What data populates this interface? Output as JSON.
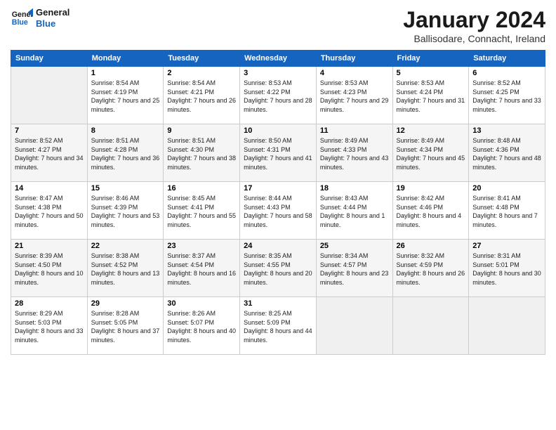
{
  "header": {
    "logo_line1": "General",
    "logo_line2": "Blue",
    "month": "January 2024",
    "location": "Ballisodare, Connacht, Ireland"
  },
  "weekdays": [
    "Sunday",
    "Monday",
    "Tuesday",
    "Wednesday",
    "Thursday",
    "Friday",
    "Saturday"
  ],
  "weeks": [
    [
      {
        "day": "",
        "empty": true
      },
      {
        "day": "1",
        "sunrise": "8:54 AM",
        "sunset": "4:19 PM",
        "daylight": "7 hours and 25 minutes."
      },
      {
        "day": "2",
        "sunrise": "8:54 AM",
        "sunset": "4:21 PM",
        "daylight": "7 hours and 26 minutes."
      },
      {
        "day": "3",
        "sunrise": "8:53 AM",
        "sunset": "4:22 PM",
        "daylight": "7 hours and 28 minutes."
      },
      {
        "day": "4",
        "sunrise": "8:53 AM",
        "sunset": "4:23 PM",
        "daylight": "7 hours and 29 minutes."
      },
      {
        "day": "5",
        "sunrise": "8:53 AM",
        "sunset": "4:24 PM",
        "daylight": "7 hours and 31 minutes."
      },
      {
        "day": "6",
        "sunrise": "8:52 AM",
        "sunset": "4:25 PM",
        "daylight": "7 hours and 33 minutes."
      }
    ],
    [
      {
        "day": "7",
        "sunrise": "8:52 AM",
        "sunset": "4:27 PM",
        "daylight": "7 hours and 34 minutes."
      },
      {
        "day": "8",
        "sunrise": "8:51 AM",
        "sunset": "4:28 PM",
        "daylight": "7 hours and 36 minutes."
      },
      {
        "day": "9",
        "sunrise": "8:51 AM",
        "sunset": "4:30 PM",
        "daylight": "7 hours and 38 minutes."
      },
      {
        "day": "10",
        "sunrise": "8:50 AM",
        "sunset": "4:31 PM",
        "daylight": "7 hours and 41 minutes."
      },
      {
        "day": "11",
        "sunrise": "8:49 AM",
        "sunset": "4:33 PM",
        "daylight": "7 hours and 43 minutes."
      },
      {
        "day": "12",
        "sunrise": "8:49 AM",
        "sunset": "4:34 PM",
        "daylight": "7 hours and 45 minutes."
      },
      {
        "day": "13",
        "sunrise": "8:48 AM",
        "sunset": "4:36 PM",
        "daylight": "7 hours and 48 minutes."
      }
    ],
    [
      {
        "day": "14",
        "sunrise": "8:47 AM",
        "sunset": "4:38 PM",
        "daylight": "7 hours and 50 minutes."
      },
      {
        "day": "15",
        "sunrise": "8:46 AM",
        "sunset": "4:39 PM",
        "daylight": "7 hours and 53 minutes."
      },
      {
        "day": "16",
        "sunrise": "8:45 AM",
        "sunset": "4:41 PM",
        "daylight": "7 hours and 55 minutes."
      },
      {
        "day": "17",
        "sunrise": "8:44 AM",
        "sunset": "4:43 PM",
        "daylight": "7 hours and 58 minutes."
      },
      {
        "day": "18",
        "sunrise": "8:43 AM",
        "sunset": "4:44 PM",
        "daylight": "8 hours and 1 minute."
      },
      {
        "day": "19",
        "sunrise": "8:42 AM",
        "sunset": "4:46 PM",
        "daylight": "8 hours and 4 minutes."
      },
      {
        "day": "20",
        "sunrise": "8:41 AM",
        "sunset": "4:48 PM",
        "daylight": "8 hours and 7 minutes."
      }
    ],
    [
      {
        "day": "21",
        "sunrise": "8:39 AM",
        "sunset": "4:50 PM",
        "daylight": "8 hours and 10 minutes."
      },
      {
        "day": "22",
        "sunrise": "8:38 AM",
        "sunset": "4:52 PM",
        "daylight": "8 hours and 13 minutes."
      },
      {
        "day": "23",
        "sunrise": "8:37 AM",
        "sunset": "4:54 PM",
        "daylight": "8 hours and 16 minutes."
      },
      {
        "day": "24",
        "sunrise": "8:35 AM",
        "sunset": "4:55 PM",
        "daylight": "8 hours and 20 minutes."
      },
      {
        "day": "25",
        "sunrise": "8:34 AM",
        "sunset": "4:57 PM",
        "daylight": "8 hours and 23 minutes."
      },
      {
        "day": "26",
        "sunrise": "8:32 AM",
        "sunset": "4:59 PM",
        "daylight": "8 hours and 26 minutes."
      },
      {
        "day": "27",
        "sunrise": "8:31 AM",
        "sunset": "5:01 PM",
        "daylight": "8 hours and 30 minutes."
      }
    ],
    [
      {
        "day": "28",
        "sunrise": "8:29 AM",
        "sunset": "5:03 PM",
        "daylight": "8 hours and 33 minutes."
      },
      {
        "day": "29",
        "sunrise": "8:28 AM",
        "sunset": "5:05 PM",
        "daylight": "8 hours and 37 minutes."
      },
      {
        "day": "30",
        "sunrise": "8:26 AM",
        "sunset": "5:07 PM",
        "daylight": "8 hours and 40 minutes."
      },
      {
        "day": "31",
        "sunrise": "8:25 AM",
        "sunset": "5:09 PM",
        "daylight": "8 hours and 44 minutes."
      },
      {
        "day": "",
        "empty": true
      },
      {
        "day": "",
        "empty": true
      },
      {
        "day": "",
        "empty": true
      }
    ]
  ]
}
